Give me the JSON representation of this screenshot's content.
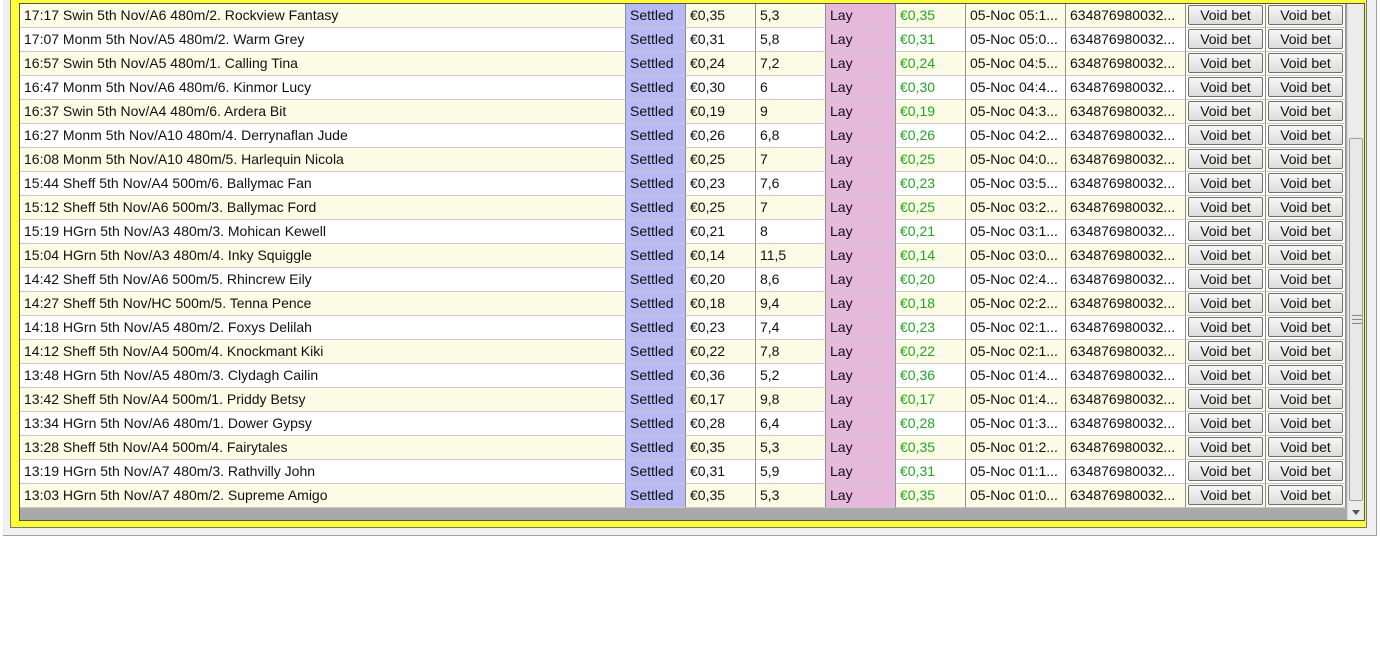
{
  "rows": [
    {
      "name": "17:17 Swin 5th Nov/A6 480m/2. Rockview Fantasy",
      "status": "Settled",
      "stake": "€0,35",
      "odds": "5,3",
      "type": "Lay",
      "liability": "€0,35",
      "date": "05-Noc 05:1...",
      "id": "634876980032...",
      "void1": "Void bet",
      "void2": "Void bet"
    },
    {
      "name": "17:07 Monm 5th Nov/A5 480m/2. Warm Grey",
      "status": "Settled",
      "stake": "€0,31",
      "odds": "5,8",
      "type": "Lay",
      "liability": "€0,31",
      "date": "05-Noc 05:0...",
      "id": "634876980032...",
      "void1": "Void bet",
      "void2": "Void bet"
    },
    {
      "name": "16:57 Swin 5th Nov/A5 480m/1. Calling Tina",
      "status": "Settled",
      "stake": "€0,24",
      "odds": "7,2",
      "type": "Lay",
      "liability": "€0,24",
      "date": "05-Noc 04:5...",
      "id": "634876980032...",
      "void1": "Void bet",
      "void2": "Void bet"
    },
    {
      "name": "16:47 Monm 5th Nov/A6 480m/6. Kinmor Lucy",
      "status": "Settled",
      "stake": "€0,30",
      "odds": "6",
      "type": "Lay",
      "liability": "€0,30",
      "date": "05-Noc 04:4...",
      "id": "634876980032...",
      "void1": "Void bet",
      "void2": "Void bet"
    },
    {
      "name": "16:37 Swin 5th Nov/A4 480m/6. Ardera Bit",
      "status": "Settled",
      "stake": "€0,19",
      "odds": "9",
      "type": "Lay",
      "liability": "€0,19",
      "date": "05-Noc 04:3...",
      "id": "634876980032...",
      "void1": "Void bet",
      "void2": "Void bet"
    },
    {
      "name": "16:27 Monm 5th Nov/A10 480m/4. Derrynaflan Jude",
      "status": "Settled",
      "stake": "€0,26",
      "odds": "6,8",
      "type": "Lay",
      "liability": "€0,26",
      "date": "05-Noc 04:2...",
      "id": "634876980032...",
      "void1": "Void bet",
      "void2": "Void bet"
    },
    {
      "name": "16:08 Monm 5th Nov/A10 480m/5. Harlequin Nicola",
      "status": "Settled",
      "stake": "€0,25",
      "odds": "7",
      "type": "Lay",
      "liability": "€0,25",
      "date": "05-Noc 04:0...",
      "id": "634876980032...",
      "void1": "Void bet",
      "void2": "Void bet"
    },
    {
      "name": "15:44 Sheff 5th Nov/A4 500m/6. Ballymac Fan",
      "status": "Settled",
      "stake": "€0,23",
      "odds": "7,6",
      "type": "Lay",
      "liability": "€0,23",
      "date": "05-Noc 03:5...",
      "id": "634876980032...",
      "void1": "Void bet",
      "void2": "Void bet"
    },
    {
      "name": "15:12 Sheff 5th Nov/A6 500m/3. Ballymac Ford",
      "status": "Settled",
      "stake": "€0,25",
      "odds": "7",
      "type": "Lay",
      "liability": "€0,25",
      "date": "05-Noc 03:2...",
      "id": "634876980032...",
      "void1": "Void bet",
      "void2": "Void bet"
    },
    {
      "name": "15:19 HGrn 5th Nov/A3 480m/3. Mohican Kewell",
      "status": "Settled",
      "stake": "€0,21",
      "odds": "8",
      "type": "Lay",
      "liability": "€0,21",
      "date": "05-Noc 03:1...",
      "id": "634876980032...",
      "void1": "Void bet",
      "void2": "Void bet"
    },
    {
      "name": "15:04 HGrn 5th Nov/A3 480m/4. Inky Squiggle",
      "status": "Settled",
      "stake": "€0,14",
      "odds": "11,5",
      "type": "Lay",
      "liability": "€0,14",
      "date": "05-Noc 03:0...",
      "id": "634876980032...",
      "void1": "Void bet",
      "void2": "Void bet"
    },
    {
      "name": "14:42 Sheff 5th Nov/A6 500m/5. Rhincrew Eily",
      "status": "Settled",
      "stake": "€0,20",
      "odds": "8,6",
      "type": "Lay",
      "liability": "€0,20",
      "date": "05-Noc 02:4...",
      "id": "634876980032...",
      "void1": "Void bet",
      "void2": "Void bet"
    },
    {
      "name": "14:27 Sheff 5th Nov/HC 500m/5. Tenna Pence",
      "status": "Settled",
      "stake": "€0,18",
      "odds": "9,4",
      "type": "Lay",
      "liability": "€0,18",
      "date": "05-Noc 02:2...",
      "id": "634876980032...",
      "void1": "Void bet",
      "void2": "Void bet"
    },
    {
      "name": "14:18 HGrn 5th Nov/A5 480m/2. Foxys Delilah",
      "status": "Settled",
      "stake": "€0,23",
      "odds": "7,4",
      "type": "Lay",
      "liability": "€0,23",
      "date": "05-Noc 02:1...",
      "id": "634876980032...",
      "void1": "Void bet",
      "void2": "Void bet"
    },
    {
      "name": "14:12 Sheff 5th Nov/A4 500m/4. Knockmant Kiki",
      "status": "Settled",
      "stake": "€0,22",
      "odds": "7,8",
      "type": "Lay",
      "liability": "€0,22",
      "date": "05-Noc 02:1...",
      "id": "634876980032...",
      "void1": "Void bet",
      "void2": "Void bet"
    },
    {
      "name": "13:48 HGrn 5th Nov/A5 480m/3. Clydagh Cailin",
      "status": "Settled",
      "stake": "€0,36",
      "odds": "5,2",
      "type": "Lay",
      "liability": "€0,36",
      "date": "05-Noc 01:4...",
      "id": "634876980032...",
      "void1": "Void bet",
      "void2": "Void bet"
    },
    {
      "name": "13:42 Sheff 5th Nov/A4 500m/1. Priddy Betsy",
      "status": "Settled",
      "stake": "€0,17",
      "odds": "9,8",
      "type": "Lay",
      "liability": "€0,17",
      "date": "05-Noc 01:4...",
      "id": "634876980032...",
      "void1": "Void bet",
      "void2": "Void bet"
    },
    {
      "name": "13:34 HGrn 5th Nov/A6 480m/1. Dower Gypsy",
      "status": "Settled",
      "stake": "€0,28",
      "odds": "6,4",
      "type": "Lay",
      "liability": "€0,28",
      "date": "05-Noc 01:3...",
      "id": "634876980032...",
      "void1": "Void bet",
      "void2": "Void bet"
    },
    {
      "name": "13:28 Sheff 5th Nov/A4 500m/4. Fairytales",
      "status": "Settled",
      "stake": "€0,35",
      "odds": "5,3",
      "type": "Lay",
      "liability": "€0,35",
      "date": "05-Noc 01:2...",
      "id": "634876980032...",
      "void1": "Void bet",
      "void2": "Void bet"
    },
    {
      "name": "13:19 HGrn 5th Nov/A7 480m/3. Rathvilly John",
      "status": "Settled",
      "stake": "€0,31",
      "odds": "5,9",
      "type": "Lay",
      "liability": "€0,31",
      "date": "05-Noc 01:1...",
      "id": "634876980032...",
      "void1": "Void bet",
      "void2": "Void bet"
    },
    {
      "name": "13:03 HGrn 5th Nov/A7 480m/2. Supreme Amigo",
      "status": "Settled",
      "stake": "€0,35",
      "odds": "5,3",
      "type": "Lay",
      "liability": "€0,35",
      "date": "05-Noc 01:0...",
      "id": "634876980032...",
      "void1": "Void bet",
      "void2": "Void bet"
    }
  ],
  "colors": {
    "frame": "#ffff33",
    "status_bg": "#b9b9f5",
    "type_bg": "#e6b8dc",
    "liability_text": "#22a822",
    "row_alt": "#fbfbe6",
    "grid_bg": "#a9a9a9"
  },
  "scrollbar": {
    "grip_icon": "grip-lines-icon",
    "down_icon": "arrow-down-icon"
  }
}
